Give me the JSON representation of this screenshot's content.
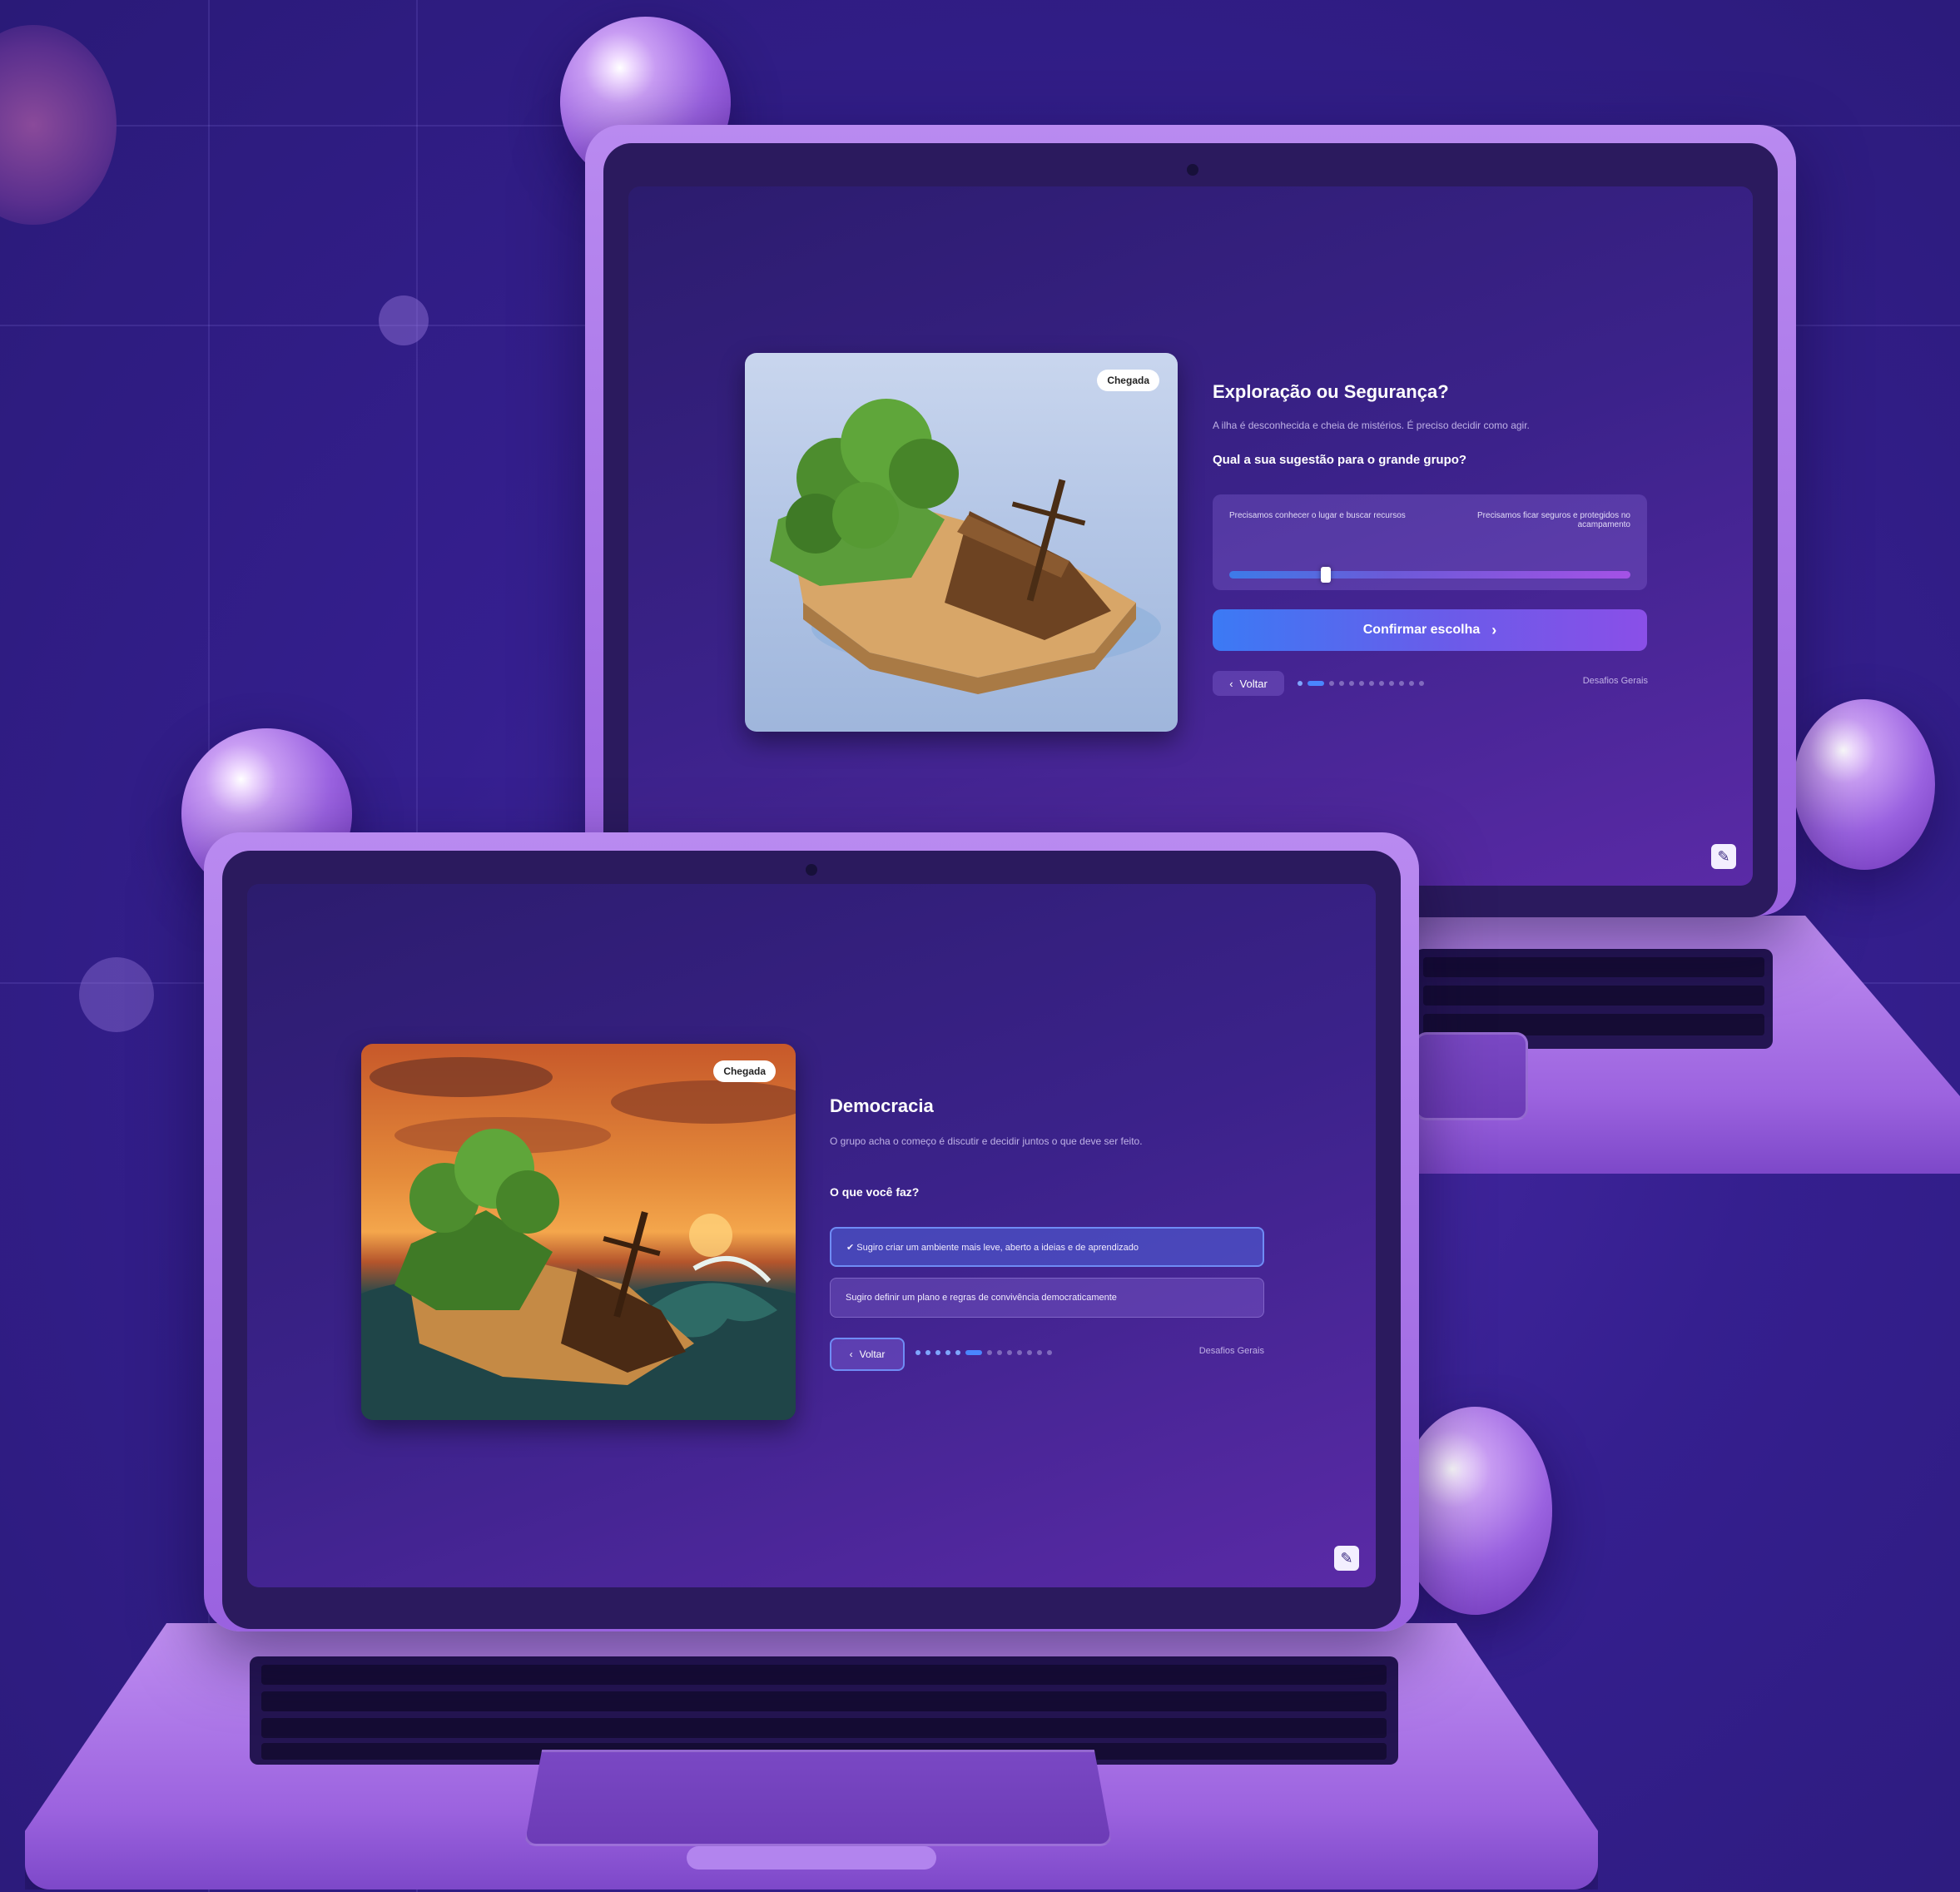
{
  "back_laptop": {
    "badge": "Chegada",
    "title": "Exploração ou Segurança?",
    "description": "A ilha é desconhecida e cheia de mistérios. É preciso decidir como agir.",
    "question": "Qual a sua sugestão para o grande grupo?",
    "slider": {
      "left_label": "Precisamos conhecer o lugar e buscar recursos",
      "right_label": "Precisamos ficar seguros e protegidos no acampamento",
      "value": 0.24
    },
    "confirm_label": "Confirmar escolha",
    "confirm_icon": "chevron-right-icon",
    "back_label": "Voltar",
    "back_icon": "chevron-left-icon",
    "progress": {
      "total": 12,
      "current": 2
    },
    "skip_label": "Desafios Gerais"
  },
  "front_laptop": {
    "badge": "Chegada",
    "title": "Democracia",
    "description": "O grupo acha o começo é discutir e decidir juntos o que deve ser feito.",
    "question": "O que você faz?",
    "options": [
      {
        "label": "✔ Sugiro criar um ambiente mais leve, aberto a ideias e de aprendizado",
        "selected": true
      },
      {
        "label": "Sugiro definir um plano e regras de convivência democraticamente",
        "selected": false
      }
    ],
    "back_label": "Voltar",
    "back_icon": "chevron-left-icon",
    "progress": {
      "total": 13,
      "current": 6
    },
    "skip_label": "Desafios Gerais"
  },
  "colors": {
    "background": "#351f8f",
    "accent_blue": "#3b7af5",
    "accent_purple": "#8a4fe8",
    "laptop_body": "#9a62e0"
  }
}
